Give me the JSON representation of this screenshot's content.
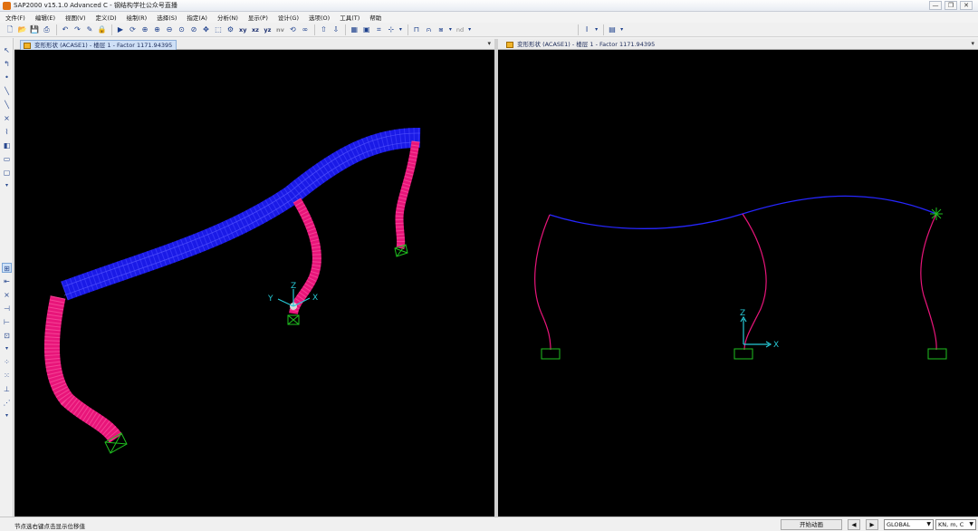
{
  "window": {
    "title": "SAP2000 v15.1.0 Advanced C  - 钢结构学社公众号直播",
    "controls": [
      "—",
      "❐",
      "✕"
    ]
  },
  "menu": [
    "文件(F)",
    "编辑(E)",
    "视图(V)",
    "定义(D)",
    "绘制(R)",
    "选择(S)",
    "指定(A)",
    "分析(N)",
    "显示(P)",
    "设计(G)",
    "选项(O)",
    "工具(T)",
    "帮助"
  ],
  "toolbar": {
    "view_labels": [
      "xy",
      "xz",
      "yz",
      "nv"
    ],
    "nd_label": "nd"
  },
  "panels": {
    "left": {
      "tab_title": "变形形状 (ACASE1) - 楼层 1 - Factor 1171.94395",
      "axis": {
        "x": "X",
        "y": "Y",
        "z": "Z"
      }
    },
    "right": {
      "tab_title": "变形形状 (ACASE1) - 楼层 1 - Factor 1171.94395",
      "axis": {
        "x": "X",
        "z": "Z"
      }
    }
  },
  "status": {
    "hint": "节点选右键点击显示位移值",
    "animate_button": "开始动画",
    "nav_prev": "◀",
    "nav_next": "▶",
    "coord_system": "GLOBAL",
    "units": "KN, m, C"
  },
  "colors": {
    "beam": "#1a1aff",
    "column": "#e8157a",
    "support": "#1fbf1f",
    "axis": "#27c9d6",
    "background": "#000000"
  }
}
